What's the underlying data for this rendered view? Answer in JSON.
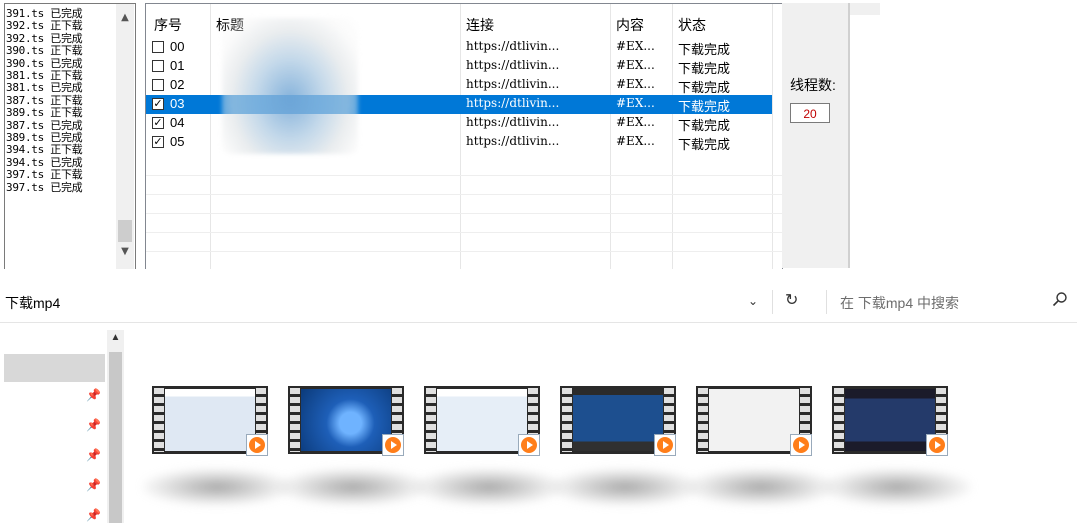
{
  "log": {
    "lines": [
      "391.ts 已完成",
      "392.ts 正下载",
      "392.ts 已完成",
      "390.ts 正下载",
      "390.ts 已完成",
      "381.ts 正下载",
      "381.ts 已完成",
      "387.ts 正下载",
      "389.ts 正下载",
      "387.ts 已完成",
      "389.ts 已完成",
      "394.ts 正下载",
      "394.ts 已完成",
      "397.ts 正下载",
      "397.ts 已完成"
    ]
  },
  "table": {
    "columns": [
      "序号",
      "标题",
      "连接",
      "内容",
      "状态"
    ],
    "rows": [
      {
        "checked": false,
        "index": "00",
        "url": "https://dtlivin...",
        "content": "#EX...",
        "status": "下载完成",
        "selected": false
      },
      {
        "checked": false,
        "index": "01",
        "url": "https://dtlivin...",
        "content": "#EX...",
        "status": "下载完成",
        "selected": false
      },
      {
        "checked": false,
        "index": "02",
        "url": "https://dtlivin...",
        "content": "#EX...",
        "status": "下载完成",
        "selected": false
      },
      {
        "checked": true,
        "index": "03",
        "url": "https://dtlivin...",
        "content": "#EX...",
        "status": "下载完成",
        "selected": true
      },
      {
        "checked": true,
        "index": "04",
        "url": "https://dtlivin...",
        "content": "#EX...",
        "status": "下载完成",
        "selected": false
      },
      {
        "checked": true,
        "index": "05",
        "url": "https://dtlivin...",
        "content": "#EX...",
        "status": "下载完成",
        "selected": false
      }
    ]
  },
  "settings": {
    "threads_label": "线程数:",
    "threads_value": "20"
  },
  "explorer": {
    "folder": "下载mp4",
    "search_placeholder": "在 下载mp4 中搜索",
    "accent_color": "#0078d7",
    "video_count_visible": 6
  }
}
